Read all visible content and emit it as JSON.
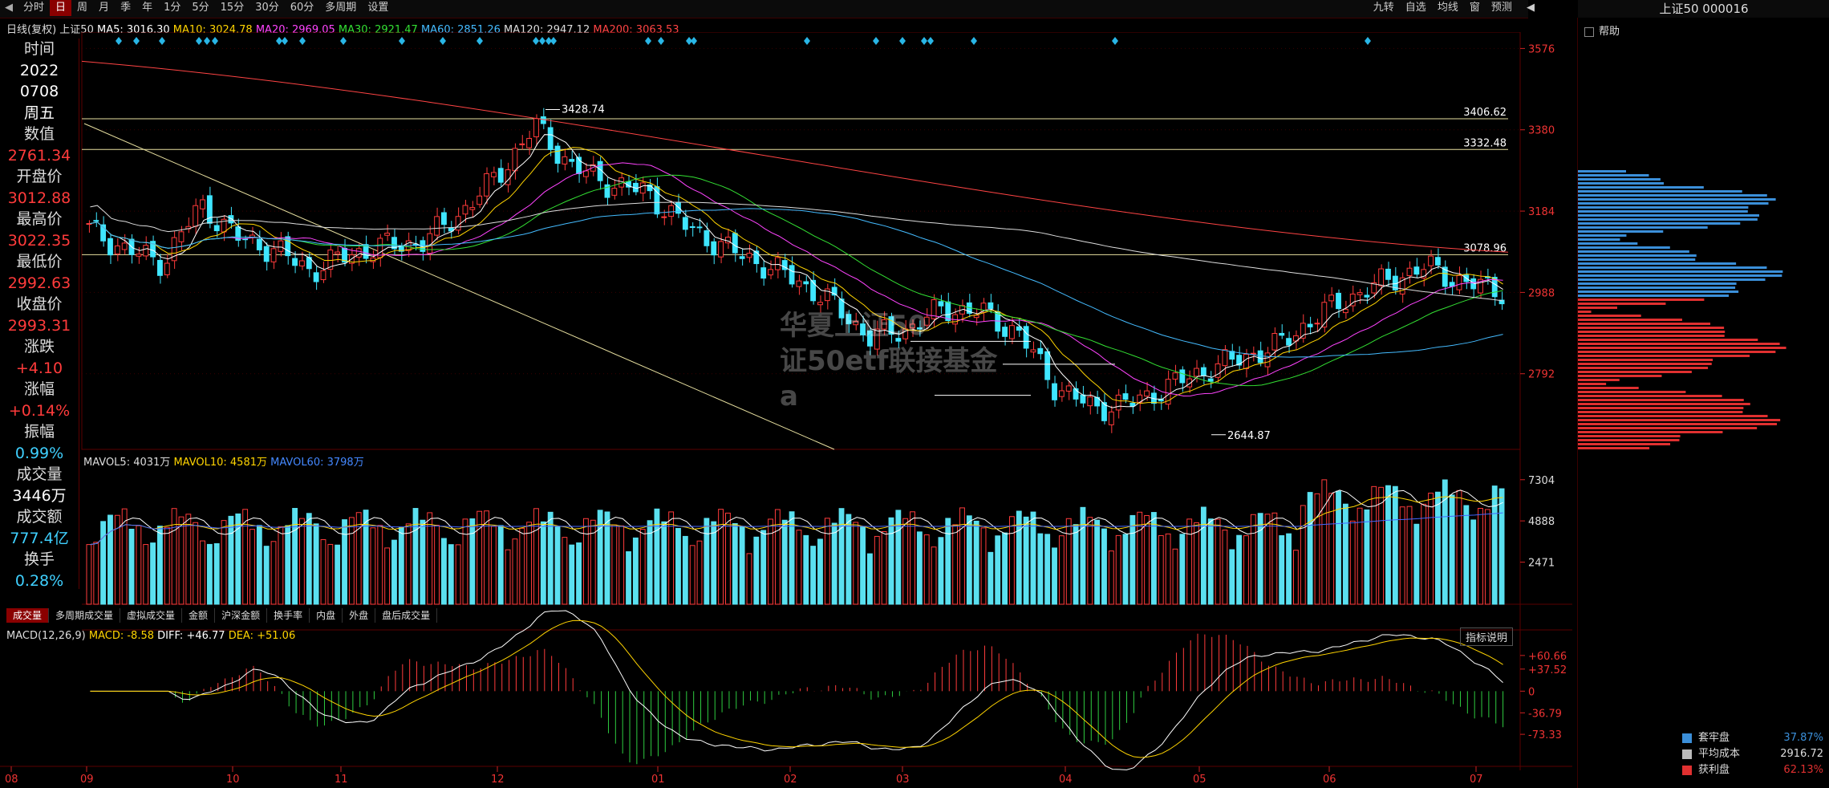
{
  "toolbar": {
    "items": [
      "分时",
      "日",
      "周",
      "月",
      "季",
      "年",
      "1分",
      "5分",
      "15分",
      "30分",
      "60分",
      "多周期",
      "设置"
    ],
    "active": "日",
    "right_items": [
      "九转",
      "自选",
      "均线",
      "窗",
      "预测"
    ]
  },
  "ma_legend": {
    "period": "日线(复权)",
    "security": "上证50",
    "ma5": "MA5: 3016.30",
    "ma10": "MA10: 3024.78",
    "ma20": "MA20: 2969.05",
    "ma30": "MA30: 2921.47",
    "ma60": "MA60: 2851.26",
    "ma120": "MA120: 2947.12",
    "ma200": "MA200: 3063.53"
  },
  "info_panel": [
    {
      "label": "时间",
      "value": "2022",
      "value2": "0708",
      "value3": "周五",
      "color": "white"
    },
    {
      "label": "数值",
      "value": "2761.34",
      "color": "red"
    },
    {
      "label": "开盘价",
      "value": "3012.88",
      "color": "red"
    },
    {
      "label": "最高价",
      "value": "3022.35",
      "color": "red"
    },
    {
      "label": "最低价",
      "value": "2992.63",
      "color": "red"
    },
    {
      "label": "收盘价",
      "value": "2993.31",
      "color": "red"
    },
    {
      "label": "涨跌",
      "value": "+4.10",
      "color": "red"
    },
    {
      "label": "涨幅",
      "value": "+0.14%",
      "color": "red"
    },
    {
      "label": "振幅",
      "value": "0.99%",
      "color": "cyan"
    },
    {
      "label": "成交量",
      "value": "3446万",
      "color": "white"
    },
    {
      "label": "成交额",
      "value": "777.4亿",
      "color": "cyan"
    },
    {
      "label": "换手",
      "value": "0.28%",
      "color": "cyan"
    }
  ],
  "price_axis": [
    "3576",
    "3380",
    "3184",
    "2988",
    "2792"
  ],
  "price_annotations": {
    "high": "3428.74",
    "low": "2644.87",
    "level1": "3406.62",
    "level2": "3332.48",
    "level3": "3078.96"
  },
  "vol_legend": {
    "mavol5": "MAVOL5: 4031万",
    "mavol10": "MAVOL10: 4581万",
    "mavol60": "MAVOL60: 3798万"
  },
  "vol_axis": [
    "7304",
    "4888",
    "2471"
  ],
  "tabs": [
    "成交量",
    "多周期成交量",
    "虚拟成交量",
    "金额",
    "沪深金额",
    "换手率",
    "内盘",
    "外盘",
    "盘后成交量"
  ],
  "active_tab": "成交量",
  "macd_legend": {
    "name": "MACD(12,26,9)",
    "macd": "MACD: -8.58",
    "diff": "DIFF: +46.77",
    "dea": "DEA: +51.06"
  },
  "macd_axis": [
    "+60.66",
    "+37.52",
    "0",
    "-36.79",
    "-73.33"
  ],
  "macd_button": "指标说明",
  "x_axis": [
    "08",
    "09",
    "10",
    "11",
    "12",
    "01",
    "02",
    "03",
    "04",
    "05",
    "06",
    "07"
  ],
  "watermark": [
    "华夏上证50",
    "证50etf联接基金",
    "a"
  ],
  "right_panel": {
    "title": "上证50 000016",
    "help": "帮助",
    "stats": [
      {
        "label": "套牢盘",
        "value": "37.87%",
        "color": "#3b8fd9"
      },
      {
        "label": "平均成本",
        "value": "2916.72",
        "color": "#bbbbbb"
      },
      {
        "label": "获利盘",
        "value": "62.13%",
        "color": "#e03030"
      }
    ]
  },
  "chart_data": {
    "type": "candlestick",
    "title": "上证50",
    "price_range": [
      2600,
      3600
    ],
    "months": [
      "08",
      "09",
      "10",
      "11",
      "12",
      "01",
      "02",
      "03",
      "04",
      "05",
      "06",
      "07"
    ],
    "close_trend": [
      3140,
      3090,
      3060,
      3200,
      3120,
      3090,
      3040,
      3080,
      3100,
      3110,
      3180,
      3270,
      3390,
      3290,
      3250,
      3230,
      3150,
      3100,
      3060,
      3020,
      2960,
      2880,
      2900,
      2950,
      2940,
      2890,
      2760,
      2710,
      2720,
      2760,
      2800,
      2830,
      2860,
      2930,
      2980,
      3020,
      3050,
      3010,
      2993
    ],
    "volume_range": [
      0,
      8000
    ],
    "macd_range": [
      -80,
      70
    ]
  }
}
